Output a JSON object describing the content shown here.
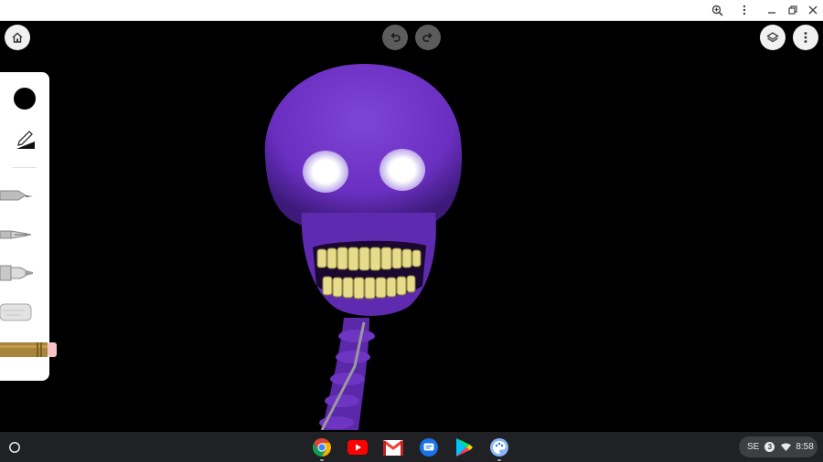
{
  "window": {
    "titlebar_icons": [
      "zoom-icon",
      "more-vertical-icon",
      "minimize-icon",
      "restore-icon",
      "close-icon"
    ]
  },
  "toolbar": {
    "home_icon": "home-icon",
    "undo_icon": "undo-icon",
    "redo_icon": "redo-icon",
    "layers_icon": "layers-icon",
    "menu_icon": "more-vertical-icon"
  },
  "tools": {
    "color_swatch": "#000000",
    "items": [
      "pen-size-icon",
      "pencil-tool",
      "fountain-pen-tool",
      "marker-tool",
      "chalk-tool",
      "graphite-pencil-tool"
    ]
  },
  "colors": {
    "skull": "#6a2fc0",
    "teeth": "#e6dc8c",
    "shelf": "#1f2124"
  },
  "shelf": {
    "apps": [
      "chrome-icon",
      "youtube-icon",
      "gmail-icon",
      "messages-icon",
      "play-store-icon",
      "canvas-app-icon"
    ],
    "tray": {
      "ime": "SE",
      "notification_count": "3",
      "time": "8:58"
    }
  }
}
